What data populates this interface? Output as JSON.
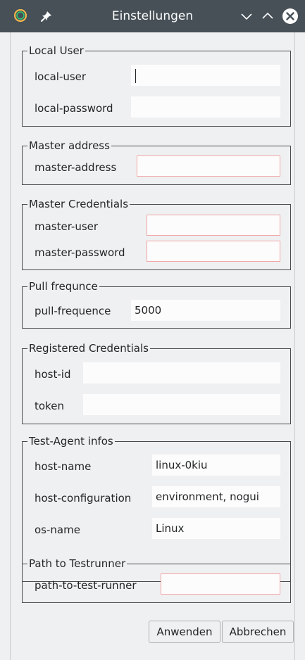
{
  "window": {
    "title": "Einstellungen",
    "icons": {
      "app": "app-ring-icon",
      "pin": "pin-icon",
      "minimize": "chevron-down-icon",
      "maximize": "chevron-up-icon",
      "close": "close-icon"
    }
  },
  "groups": {
    "local_user": {
      "title": "Local User",
      "user_label": "local-user",
      "user_value": "",
      "password_label": "local-password",
      "password_value": ""
    },
    "master_address": {
      "title": "Master address",
      "label": "master-address",
      "value": ""
    },
    "master_credentials": {
      "title": "Master Credentials",
      "user_label": "master-user",
      "user_value": "",
      "password_label": "master-password",
      "password_value": ""
    },
    "pull_frequence": {
      "title": "Pull frequnce",
      "label": "pull-frequence",
      "value": "5000"
    },
    "registered_credentials": {
      "title": "Registered Credentials",
      "host_id_label": "host-id",
      "host_id_value": "",
      "token_label": "token",
      "token_value": ""
    },
    "test_agent_infos": {
      "title": "Test-Agent infos",
      "host_name_label": "host-name",
      "host_name_value": "linux-0kiu",
      "host_config_label": "host-configuration",
      "host_config_value": "environment, nogui",
      "os_name_label": "os-name",
      "os_name_value": "Linux"
    },
    "path_to_testrunner": {
      "title": "Path to Testrunner",
      "label": "path-to-test-runner",
      "value": ""
    }
  },
  "buttons": {
    "apply": "Anwenden",
    "cancel": "Abbrechen"
  },
  "colors": {
    "titlebar": "#475057",
    "background": "#eff0f1",
    "field": "#fcfcfc",
    "error_border": "#f3a6a6",
    "text": "#232627"
  }
}
